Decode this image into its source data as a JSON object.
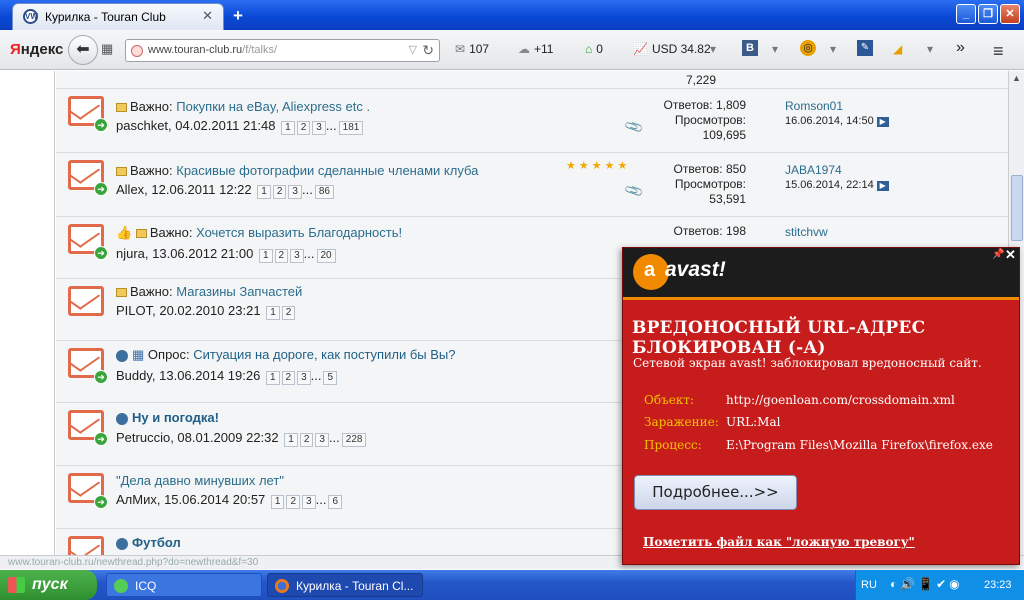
{
  "window": {
    "tab_title": "Курилка - Touran Club",
    "favicon": "VW",
    "new_tab": "+",
    "minimize": "_",
    "maximize": "❐",
    "close": "✕"
  },
  "toolbar": {
    "yandex_logo_first": "Я",
    "yandex_logo_rest": "ндекс",
    "back": "⬅",
    "url_domain": "www.touran-club.ru",
    "url_path": "/f/talks/",
    "mail_count": "107",
    "weather": "+11",
    "notif_count": "0",
    "usd_rate": "USD 34.82",
    "vk_letter": "В",
    "more": "»",
    "menu": "≡"
  },
  "page": {
    "top_value": "7,229",
    "threads": [
      {
        "prefix": "Важно:",
        "title": "Покупки на eBay, Aliexpress etc .",
        "author_date": "paschket, 04.02.2011 21:48",
        "pages": [
          "1",
          "2",
          "3",
          "...",
          "181"
        ],
        "replies": "Ответов: 1,809",
        "views_label": "Просмотров:",
        "views": "109,695",
        "last_user": "Romson01",
        "last_date": "16.06.2014, 14:50"
      },
      {
        "prefix": "Важно:",
        "title": "Красивые фотографии сделанные членами клуба",
        "author_date": "Allex, 12.06.2011 12:22",
        "pages": [
          "1",
          "2",
          "3",
          "...",
          "86"
        ],
        "replies": "Ответов: 850",
        "views_label": "Просмотров:",
        "views": "53,591",
        "last_user": "JABA1974",
        "last_date": "15.06.2014, 22:14",
        "stars": "★★★★★"
      },
      {
        "prefix": "Важно:",
        "title": "Хочется выразить Благодарность!",
        "author_date": "njura, 13.06.2012 21:00",
        "pages": [
          "1",
          "2",
          "3",
          "...",
          "20"
        ],
        "replies": "Ответов: 198",
        "last_user": "stitchvw"
      },
      {
        "prefix": "Важно:",
        "title": "Магазины Запчастей",
        "author_date": "PILOT, 20.02.2010 23:21",
        "pages": [
          "1",
          "2"
        ]
      },
      {
        "prefix": "Опрос:",
        "title": "Ситуация на дороге, как поступили бы Вы?",
        "author_date": "Buddy, 13.06.2014 19:26",
        "pages": [
          "1",
          "2",
          "3",
          "...",
          "5"
        ]
      },
      {
        "title": "Ну и погодка!",
        "author_date": "Petruccio, 08.01.2009 22:32",
        "pages": [
          "1",
          "2",
          "3",
          "...",
          "228"
        ]
      },
      {
        "title": "\"Дела давно минувших лет\"",
        "author_date": "АлМих, 15.06.2014 20:57",
        "pages": [
          "1",
          "2",
          "3",
          "...",
          "6"
        ]
      },
      {
        "title": "Футбол"
      }
    ],
    "status_url": "www.touran-club.ru/newthread.php?do=newthread&f=30"
  },
  "avast": {
    "brand": "avast!",
    "title": "ВРЕДОНОСНЫЙ URL-АДРЕС БЛОКИРОВАН (-А)",
    "message": "Сетевой экран avast! заблокировал вредоносный сайт.",
    "object_label": "Объект:",
    "object_value": "http://goenloan.com/crossdomain.xml",
    "infection_label": "Заражение:",
    "infection_value": "URL:Mal",
    "process_label": "Процесс:",
    "process_value": "E:\\Program Files\\Mozilla Firefox\\firefox.exe",
    "more_button": "Подробнее...>>",
    "false_alarm": "Пометить файл как \"ложную тревогу\""
  },
  "taskbar": {
    "start": "пуск",
    "task_icq": "ICQ",
    "task_firefox": "Курилка - Touran Cl...",
    "lang": "RU",
    "clock": "23:23"
  }
}
